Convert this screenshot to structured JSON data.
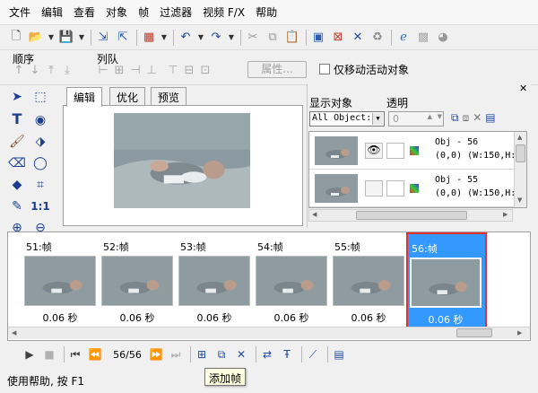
{
  "menu": [
    "文件",
    "编辑",
    "查看",
    "对象",
    "帧",
    "过滤器",
    "视频 F/X",
    "帮助"
  ],
  "toolbar_icons": [
    "new-icon",
    "open-icon",
    "dropdown",
    "save-icon",
    "dropdown",
    "import-icon",
    "export-icon",
    "color-icon",
    "dropdown",
    "undo-icon",
    "dropdown",
    "redo-icon",
    "dropdown",
    "cut-icon",
    "copy-icon",
    "paste-icon",
    "frame-icon",
    "delete-icon",
    "crop-icon",
    "recycle-icon",
    "ie-icon",
    "grid-icon",
    "help-icon"
  ],
  "order": {
    "label_order": "顺序",
    "label_align": "列队",
    "properties_button": "属性...",
    "move_active_only": "仅移动活动对象"
  },
  "editor": {
    "tabs": [
      "编辑",
      "优化",
      "预览"
    ]
  },
  "objects": {
    "show_label": "显示对象",
    "transparency_label": "透明",
    "filter_value": "All Object:",
    "transparency_value": "0",
    "rows": [
      {
        "name": "Obj - 56",
        "info": "(0,0) (W:150,H:"
      },
      {
        "name": "Obj - 55",
        "info": "(0,0) (W:150,H:"
      }
    ]
  },
  "frames": [
    {
      "label": "51:帧",
      "delay": "0.06 秒",
      "selected": false
    },
    {
      "label": "52:帧",
      "delay": "0.06 秒",
      "selected": false
    },
    {
      "label": "53:帧",
      "delay": "0.06 秒",
      "selected": false
    },
    {
      "label": "54:帧",
      "delay": "0.06 秒",
      "selected": false
    },
    {
      "label": "55:帧",
      "delay": "0.06 秒",
      "selected": false
    },
    {
      "label": "56:帧",
      "delay": "0.06 秒",
      "selected": true
    }
  ],
  "playback": {
    "counter": "56/56",
    "tooltip": "添加帧"
  },
  "status": "使用帮助, 按 F1",
  "colors": {
    "selection": "#3399ff",
    "selection_outline": "#e03030"
  }
}
